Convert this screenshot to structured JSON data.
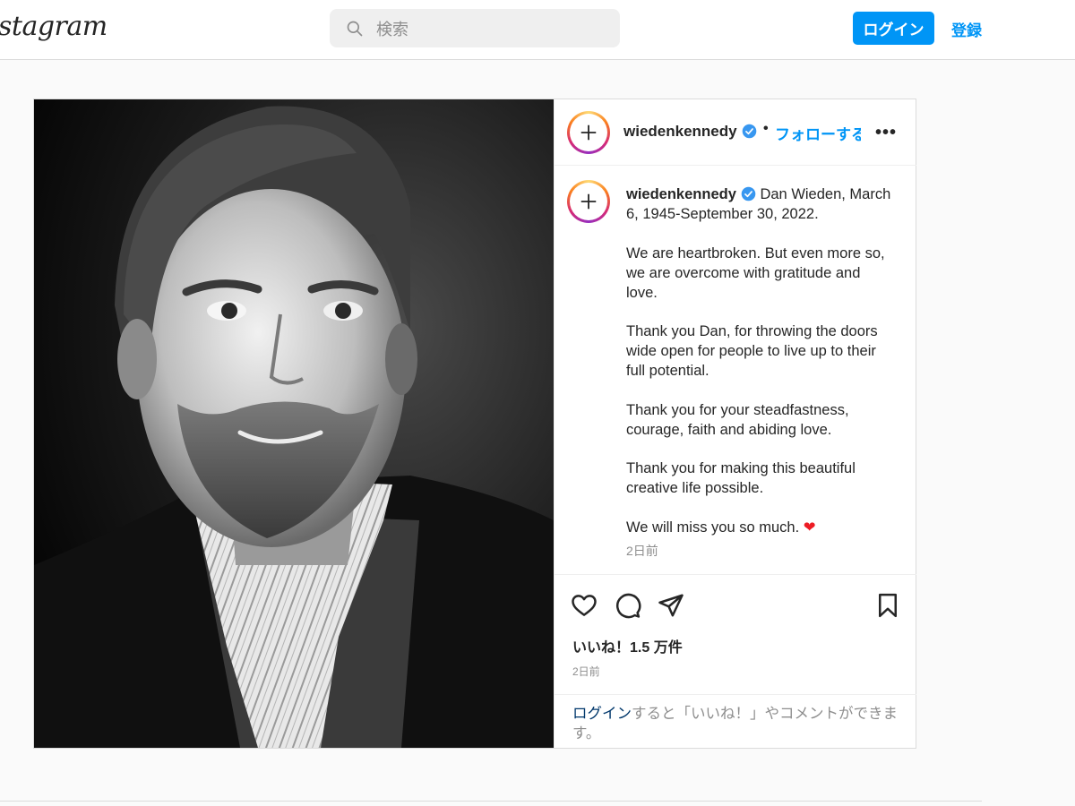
{
  "nav": {
    "logo": "stagram",
    "search_placeholder": "検索",
    "login_button": "ログイン",
    "signup_link": "登録"
  },
  "post": {
    "header": {
      "username": "wiedenkennedy",
      "separator": "•",
      "follow": "フォローする",
      "more": "•••"
    },
    "caption": {
      "username": "wiedenkennedy",
      "paragraphs": [
        "Dan Wieden, March 6, 1945-September 30, 2022.",
        "We are heartbroken. But even more so, we are overcome with gratitude and love.",
        "Thank you Dan, for throwing the doors wide open for people to live up to their full potential.",
        "Thank you for your steadfastness, courage, faith and abiding love.",
        "Thank you for making this beautiful creative life possible.",
        "We will miss you so much."
      ],
      "emoji": "❤",
      "time": "2日前"
    },
    "likes": "いいね！1.5 万件",
    "time": "2日前",
    "login_prompt": {
      "link": "ログイン",
      "text": "すると「いいね！」やコメントができます。"
    }
  },
  "colors": {
    "accent": "#0095f6",
    "border": "#dbdbdb",
    "muted": "#8e8e8e"
  },
  "icons": [
    "search-icon",
    "add-icon",
    "verified-badge-icon",
    "more-options-icon",
    "heart-icon",
    "comment-icon",
    "share-icon",
    "bookmark-icon"
  ]
}
